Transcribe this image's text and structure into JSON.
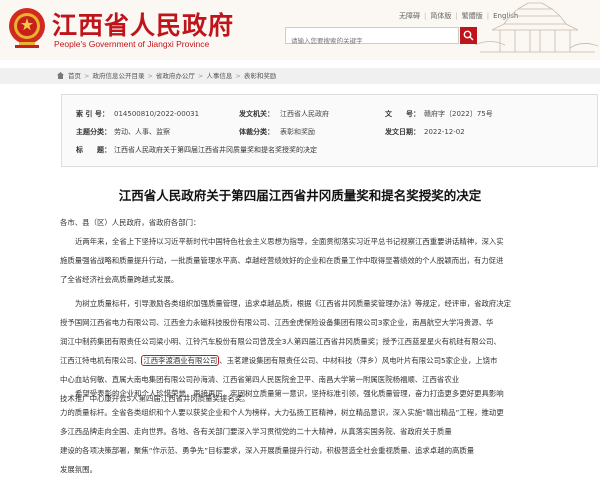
{
  "site": {
    "title": "江西省人民政府",
    "subtitle": "People's Government of Jiangxi Province",
    "top_links": [
      "无障碍",
      "简体版",
      "繁體版",
      "English"
    ],
    "search_placeholder": "请输入您要搜索的关键字"
  },
  "breadcrumb": [
    "首页",
    "政府信息公开目录",
    "省政府办公厅",
    "人事信息",
    "表彰和奖励"
  ],
  "info": {
    "index_label": "索 引 号：",
    "index_value": "014500810/2022-00031",
    "issuer_label": "发文机关：",
    "issuer_value": "江西省人民政府",
    "docno_label": "文　　号：",
    "docno_value": "赣府字〔2022〕75号",
    "category_label": "主题分类：",
    "category_value": "劳动、人事、监察",
    "genre_label": "体裁分类：",
    "genre_value": "表彰和奖励",
    "date_label": "发文日期：",
    "date_value": "2022-12-02",
    "title_label": "标　　题：",
    "title_value": "江西省人民政府关于第四届江西省井冈质量奖和提名奖授奖的决定"
  },
  "article": {
    "title": "江西省人民政府关于第四届江西省井冈质量奖和提名奖授奖的决定",
    "salutation": "各市、县（区）人民政府，省政府各部门：",
    "p1": [
      "近两年来，全省上下坚持以习近平新时代中国特色社会主义思想为指导，全面贯彻落实习近平总书记视察江西重要讲话精神，深入实",
      "施质量强省战略和质量提升行动，一批质量管理水平高、卓越经营绩效好的企业和在质量工作中取得显著绩效的个人脱颖而出，有力促进",
      "了全省经济社会高质量跨越式发展。"
    ],
    "p2_lines": [
      "为树立质量标杆，引导激励各类组织加强质量管理，追求卓越品质，根据《江西省井冈质量奖管理办法》等规定，经评审，省政府决定",
      "授予国网江西省电力有限公司、江西金力永磁科技股份有限公司、江西金虎保险设备集团有限公司3家企业，南昌航空大学冯贵源、华",
      "润江中制药集团有限责任公司梁小明、江铃汽车股份有限公司曾茂全3人第四届江西省井冈质量奖；授予江西蓝星星火有机硅有限公司、"
    ],
    "p2_line4_before": "江西江特电机有限公司、",
    "p2_highlight": "江西李渡酒业有限公司",
    "p2_line4_after": "、玉茗建设集团有限责任公司、中材科技（萍乡）风电叶片有限公司5家企业，上饶市",
    "p2_lines_tail": [
      "中心血站何敏、直属大南电集团有限公司孙海清、江西省第四人民医院金卫平、南昌大学第一附属医院杨福顺、江西省农业",
      "技术推广中心康升云5人第四届江西省井冈质量奖提名奖。"
    ],
    "p3": [
      "希望受表彰的企业和个人珍惜荣誉，再接再厉，牢固树立质量第一意识，坚持标准引领，强化质量管理，奋力打造更多更好更具影响",
      "力的质量标杆。全省各类组织和个人要以获奖企业和个人为榜样，大力弘扬工匠精神，树立精品意识，深入实施“赣出精品”工程，推动更",
      "多江西品牌走向全国、走向世界。各地、各有关部门要深入学习贯彻党的二十大精神，从真落实国务院、省政府关于质量",
      "建设的各项决策部署，聚焦“作示范、勇争先”目标要求，深入开展质量提升行动，积极营造全社会重视质量、追求卓越的高质量",
      "发展氛围。"
    ]
  },
  "colors": {
    "brand_red": "#c0141b",
    "highlight_border": "#d4141b"
  }
}
